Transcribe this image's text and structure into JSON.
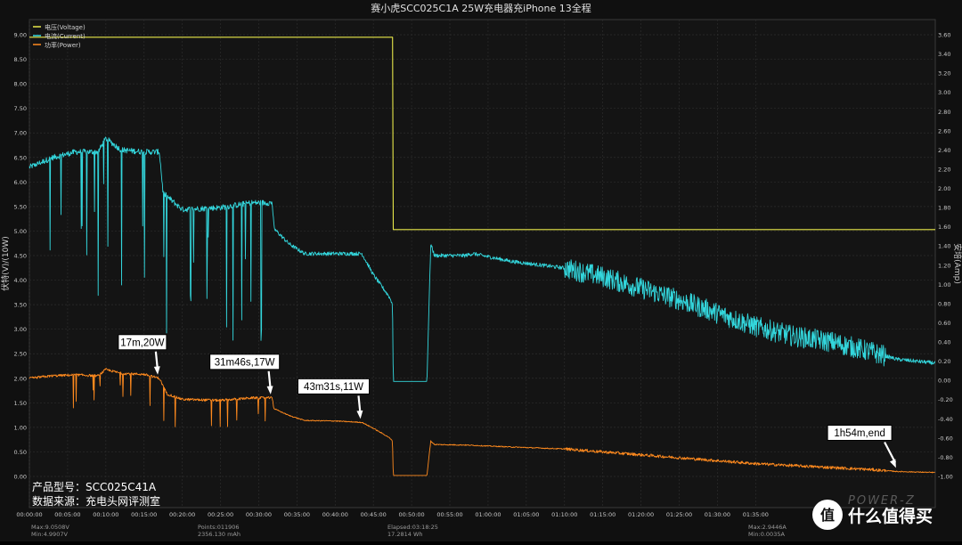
{
  "chart_data": {
    "type": "line",
    "title": "赛小虎SCC025C1A 25W充电器充iPhone 13全程",
    "ylabel_left": "伏特(V)/(10W)",
    "ylabel_right": "安培(Amp)",
    "y_left_range": [
      0,
      9.0
    ],
    "y_right_range": [
      -1.2,
      3.7
    ],
    "x_range_minutes": [
      0,
      118.5
    ],
    "grid": true,
    "legend_position": "top-left",
    "legend": [
      {
        "label": "电压(Voltage)",
        "color": "#e8e84a"
      },
      {
        "label": "电流(Current)",
        "color": "#33d6dc"
      },
      {
        "label": "功率(Power)",
        "color": "#ff8a1e"
      }
    ],
    "left_ticks": [
      "9.00",
      "8.50",
      "8.00",
      "7.50",
      "7.00",
      "6.50",
      "6.00",
      "5.50",
      "5.00",
      "4.50",
      "4.00",
      "3.50",
      "3.00",
      "2.50",
      "2.00",
      "1.50",
      "1.00",
      "0.50",
      "0.00"
    ],
    "right_ticks": [
      "3.60",
      "3.40",
      "3.20",
      "3.00",
      "2.80",
      "2.60",
      "2.40",
      "2.20",
      "2.00",
      "1.80",
      "1.60",
      "1.40",
      "1.20",
      "1.00",
      "0.80",
      "0.60",
      "0.40",
      "0.20",
      "0.00",
      "-0.20",
      "-0.40",
      "-0.60",
      "-0.80",
      "-1.00"
    ],
    "x_ticks": [
      "00:00:00",
      "00:05:00",
      "00:10:00",
      "00:15:00",
      "00:20:00",
      "00:25:00",
      "00:30:00",
      "00:35:00",
      "00:40:00",
      "00:45:00",
      "00:50:00",
      "00:55:00",
      "01:00:00",
      "01:05:00",
      "01:10:00",
      "01:15:00",
      "01:20:00",
      "01:25:00",
      "01:30:00",
      "01:35:00"
    ],
    "series": [
      {
        "name": "电压(Voltage)",
        "axis": "left",
        "points": [
          [
            0,
            8.95
          ],
          [
            47.5,
            8.95
          ],
          [
            47.6,
            5.03
          ],
          [
            118.5,
            5.03
          ]
        ]
      },
      {
        "name": "电流(Current)",
        "axis": "right",
        "points": [
          [
            0,
            2.22
          ],
          [
            3,
            2.32
          ],
          [
            6,
            2.38
          ],
          [
            9,
            2.38
          ],
          [
            10,
            2.52
          ],
          [
            12,
            2.4
          ],
          [
            15,
            2.38
          ],
          [
            17,
            2.38
          ],
          [
            17.5,
            1.95
          ],
          [
            20,
            1.78
          ],
          [
            25,
            1.8
          ],
          [
            29,
            1.85
          ],
          [
            31.77,
            1.85
          ],
          [
            32,
            1.58
          ],
          [
            34,
            1.42
          ],
          [
            36,
            1.32
          ],
          [
            40,
            1.32
          ],
          [
            43.5,
            1.32
          ],
          [
            45,
            1.1
          ],
          [
            47,
            0.88
          ],
          [
            47.5,
            0.8
          ],
          [
            47.6,
            -0.01
          ],
          [
            52,
            -0.01
          ],
          [
            52.5,
            1.42
          ],
          [
            53,
            1.3
          ],
          [
            57,
            1.3
          ],
          [
            58,
            1.32
          ],
          [
            63,
            1.24
          ],
          [
            70,
            1.17
          ],
          [
            75,
            1.08
          ],
          [
            80,
            0.96
          ],
          [
            85,
            0.84
          ],
          [
            90,
            0.7
          ],
          [
            95,
            0.56
          ],
          [
            100,
            0.46
          ],
          [
            105,
            0.4
          ],
          [
            110,
            0.3
          ],
          [
            113.5,
            0.22
          ],
          [
            118.5,
            0.18
          ]
        ]
      },
      {
        "name": "功率(Power)",
        "axis": "left",
        "points": [
          [
            0,
            2.0
          ],
          [
            3,
            2.05
          ],
          [
            6,
            2.07
          ],
          [
            9,
            2.05
          ],
          [
            10,
            2.18
          ],
          [
            12,
            2.1
          ],
          [
            15,
            2.08
          ],
          [
            17,
            2.0
          ],
          [
            18,
            1.68
          ],
          [
            20,
            1.57
          ],
          [
            25,
            1.55
          ],
          [
            29,
            1.6
          ],
          [
            31.77,
            1.6
          ],
          [
            32,
            1.38
          ],
          [
            34,
            1.24
          ],
          [
            36,
            1.14
          ],
          [
            40,
            1.13
          ],
          [
            43.52,
            1.1
          ],
          [
            45,
            0.98
          ],
          [
            47,
            0.8
          ],
          [
            47.5,
            0.72
          ],
          [
            47.6,
            0.02
          ],
          [
            52,
            0.02
          ],
          [
            52.5,
            0.72
          ],
          [
            53,
            0.65
          ],
          [
            57,
            0.64
          ],
          [
            63,
            0.6
          ],
          [
            70,
            0.56
          ],
          [
            75,
            0.5
          ],
          [
            80,
            0.44
          ],
          [
            85,
            0.38
          ],
          [
            90,
            0.32
          ],
          [
            95,
            0.26
          ],
          [
            100,
            0.22
          ],
          [
            105,
            0.18
          ],
          [
            110,
            0.14
          ],
          [
            113.5,
            0.1
          ],
          [
            118.5,
            0.08
          ]
        ]
      }
    ],
    "annotations": [
      {
        "label": "17m,20W",
        "x": 17,
        "y": 2.0
      },
      {
        "label": "31m46s,17W",
        "x": 31.77,
        "y": 1.6
      },
      {
        "label": "43m31s,11W",
        "x": 43.52,
        "y": 1.1
      },
      {
        "label": "1h54m,end",
        "x": 113.5,
        "y": 0.1
      }
    ]
  },
  "info_box": {
    "model": "产品型号：SCC025C41A",
    "source": "数据来源：充电头网评测室"
  },
  "footer": {
    "max_v": "Max:9.0508V",
    "min_v": "Min:4.9907V",
    "points": "Points:011906",
    "capacity": "2356.130 mAh",
    "elapsed": "Elapsed:03:18:25",
    "energy": "17.2814 Wh",
    "max_a": "Max:2.9446A",
    "min_a": "Min:0.0035A"
  },
  "brand": {
    "watermark": "POWER-Z",
    "logo_text": "什么值得买"
  }
}
